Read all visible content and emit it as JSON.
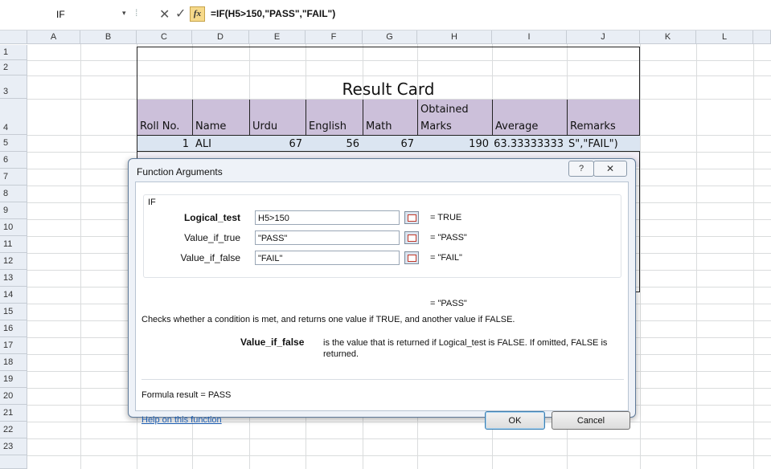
{
  "formula_bar": {
    "name_box": "IF",
    "name_box_dropdown": "▾",
    "cancel_symbol": "✕",
    "enter_symbol": "✓",
    "fx_label": "fx",
    "formula": "=IF(H5>150,\"PASS\",\"FAIL\")"
  },
  "columns": [
    "A",
    "B",
    "C",
    "D",
    "E",
    "F",
    "G",
    "H",
    "I",
    "J",
    "K",
    "L"
  ],
  "rows": [
    "1",
    "2",
    "3",
    "4",
    "5",
    "6",
    "7",
    "8",
    "9",
    "10",
    "11",
    "12",
    "13",
    "14",
    "15",
    "16",
    "17",
    "18",
    "19",
    "20",
    "21",
    "22",
    "23"
  ],
  "sheet": {
    "title": "Result Card",
    "headers": {
      "roll": "Roll No.",
      "name": "Name",
      "urdu": "Urdu",
      "english": "English",
      "math": "Math",
      "obtained_1": "Obtained",
      "obtained_2": "Marks",
      "average": "Average",
      "remarks": "Remarks"
    },
    "row5": {
      "roll": "1",
      "name": "ALI",
      "urdu": "67",
      "english": "56",
      "math": "67",
      "obtained": "190",
      "average": "63.33333333",
      "remarks": "S\",\"FAIL\")"
    }
  },
  "dialog": {
    "title": "Function Arguments",
    "help_button": "?",
    "close_button": "✕",
    "function_name": "IF",
    "args": [
      {
        "label": "Logical_test",
        "value": "H5>150",
        "result": "=  TRUE",
        "bold": true
      },
      {
        "label": "Value_if_true",
        "value": "\"PASS\"",
        "result": "=  \"PASS\"",
        "bold": false
      },
      {
        "label": "Value_if_false",
        "value": "\"FAIL\"",
        "result": "=  \"FAIL\"",
        "bold": false
      }
    ],
    "function_result": "=  \"PASS\"",
    "description": "Checks whether a condition is met, and returns one value if TRUE, and another value if FALSE.",
    "arg_desc_label": "Value_if_false",
    "arg_desc_text": "is the value that is returned if Logical_test is FALSE. If omitted, FALSE is returned.",
    "formula_result": "Formula result =  PASS",
    "help_link": "Help on this function",
    "ok_button": "OK",
    "cancel_button": "Cancel"
  }
}
